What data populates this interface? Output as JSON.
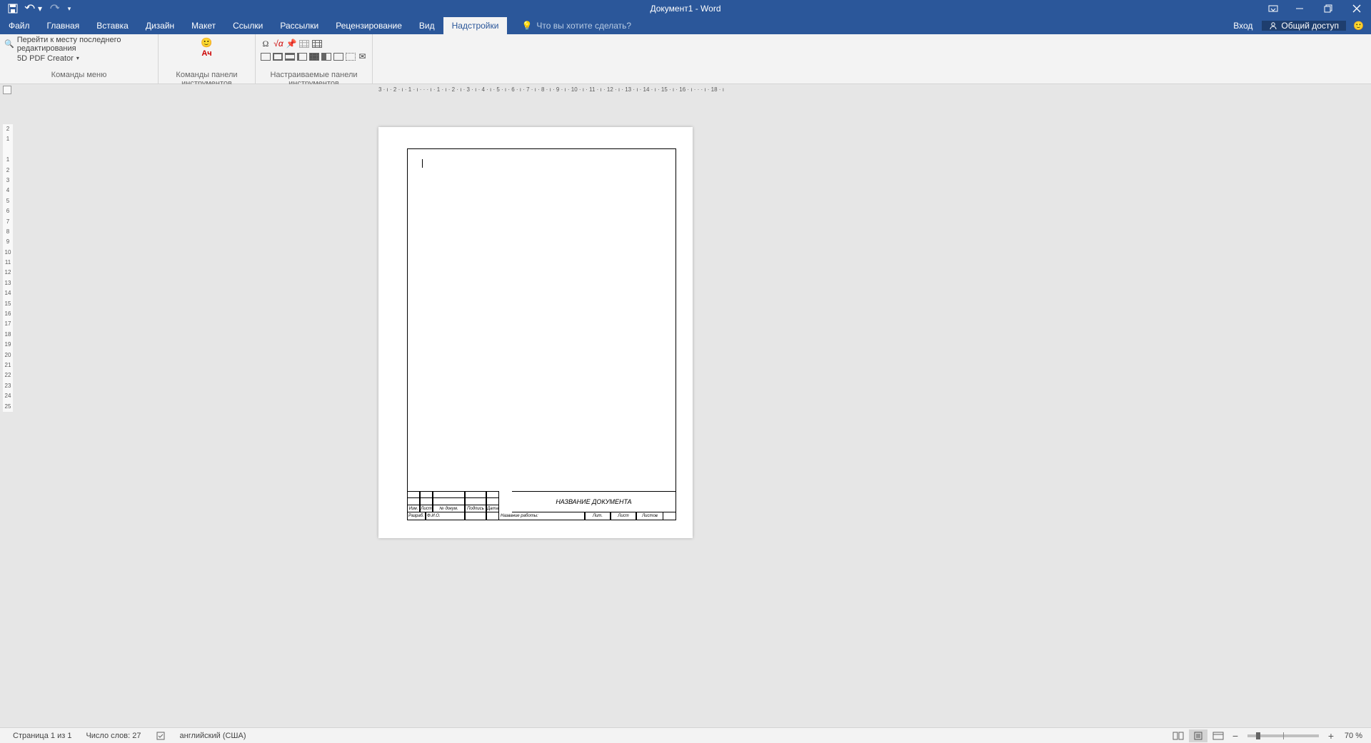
{
  "app": {
    "title": "Документ1 - Word"
  },
  "qat": {
    "save": "save",
    "undo": "undo",
    "redo": "redo",
    "customize": "customize"
  },
  "window": {
    "ribbonOpts": "ribbon-display-options"
  },
  "ribbon": {
    "tabs": {
      "file": "Файл",
      "home": "Главная",
      "insert": "Вставка",
      "design": "Дизайн",
      "layout": "Макет",
      "references": "Ссылки",
      "mailings": "Рассылки",
      "review": "Рецензирование",
      "view": "Вид",
      "addins": "Надстройки"
    },
    "tellme": {
      "placeholder": "Что вы хотите сделать?"
    },
    "signin": "Вход",
    "share": "Общий доступ"
  },
  "ribbonGroups": {
    "menuCommands": {
      "label": "Команды меню",
      "gotoLastEdit": "Перейти к месту последнего редактирования",
      "pdfCreator": "5D PDF Creator"
    },
    "toolbarCommands": {
      "label": "Команды панели инструментов"
    },
    "customToolbars": {
      "label": "Настраиваемые панели инструментов"
    }
  },
  "ruler": {
    "horizontal": "3 · ı · 2 · ı · 1 · ı · · · ı · 1 · ı · 2 · ı · 3 · ı · 4 · ı · 5 · ı · 6 · ı · 7 · ı · 8 · ı · 9 · ı · 10 · ı · 11 · ı · 12 · ı · 13 · ı · 14 · ı · 15 · ı · 16 · ı · · · ı · 18 · ı",
    "vertical": "2\n1\n\n1\n2\n3\n4\n5\n6\n7\n8\n9\n10\n11\n12\n13\n14\n15\n16\n17\n18\n19\n20\n21\n22\n23\n24\n25"
  },
  "titleBlock": {
    "docName": "НАЗВАНИЕ ДОКУМЕНТА",
    "workName": "Название работы:",
    "headers": {
      "izm": "Изм.",
      "list": "Лист",
      "ndokum": "№ докум.",
      "podpis": "Подпись",
      "data": "Дата"
    },
    "razrab": "Разраб.",
    "fio": "Ф.И.О.",
    "lit": "Лит.",
    "list2": "Лист",
    "listov": "Листов"
  },
  "status": {
    "page": "Страница 1 из 1",
    "words": "Число слов: 27",
    "lang": "английский (США)",
    "zoom": "70 %"
  }
}
